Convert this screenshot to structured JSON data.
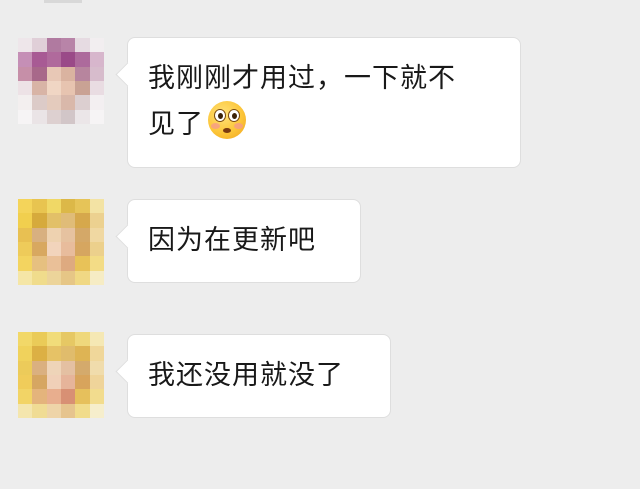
{
  "chat": {
    "messages": [
      {
        "sender": "friend-1",
        "text": "我刚刚才用过，一下就不\n见了",
        "emoji": "flushed-face-icon"
      },
      {
        "sender": "friend-2",
        "text": "因为在更新吧"
      },
      {
        "sender": "friend-2",
        "text": "我还没用就没了"
      }
    ]
  },
  "colors": {
    "background": "#ededed",
    "bubble": "#ffffff",
    "bubble_border": "#dedede",
    "text": "#191919"
  }
}
